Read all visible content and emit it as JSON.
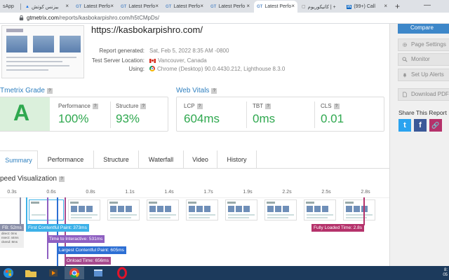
{
  "browser": {
    "tabs": [
      {
        "label": "sApp",
        "favicon": "",
        "active": false
      },
      {
        "label": "بيزنس كوتش",
        "favicon": "▲",
        "active": false
      },
      {
        "label": "Latest Perfo",
        "favicon": "GT",
        "active": false
      },
      {
        "label": "Latest Perfo",
        "favicon": "GT",
        "active": false
      },
      {
        "label": "Latest Perfo",
        "favicon": "GT",
        "active": false
      },
      {
        "label": "Latest Perfo",
        "favicon": "GT",
        "active": false
      },
      {
        "label": "Latest Perfo",
        "favicon": "GT",
        "active": true
      },
      {
        "label": "كاتيكوريوم | +",
        "favicon": "",
        "active": false
      },
      {
        "label": "(99+) Call",
        "favicon": "in",
        "active": false
      }
    ],
    "tab_close_glyph": "×",
    "new_tab_glyph": "+",
    "window_min_glyph": "—",
    "url_host": "gtmetrix.com",
    "url_path": "/reports/kasbokarpishro.com/h5tCMpDs/"
  },
  "report": {
    "site_url": "https://kasbokarpishro.com/",
    "meta": [
      {
        "label": "Report generated:",
        "value": "Sat, Feb 5, 2022 8:35 AM -0800"
      },
      {
        "label": "Test Server Location:",
        "value": "Vancouver, Canada"
      },
      {
        "label": "Using:",
        "value": "Chrome (Desktop) 90.0.4430.212, Lighthouse 8.3.0"
      }
    ]
  },
  "grade": {
    "title": "Tmetrix Grade",
    "help": "?",
    "letter": "A",
    "performance_label": "Performance",
    "performance_value": "100%",
    "structure_label": "Structure",
    "structure_value": "93%"
  },
  "vitals": {
    "title": "Web Vitals",
    "help": "?",
    "items": [
      {
        "label": "LCP",
        "value": "604ms"
      },
      {
        "label": "TBT",
        "value": "0ms"
      },
      {
        "label": "CLS",
        "value": "0.01"
      }
    ]
  },
  "tabs": [
    {
      "label": "Summary",
      "active": true
    },
    {
      "label": "Performance",
      "active": false
    },
    {
      "label": "Structure",
      "active": false
    },
    {
      "label": "Waterfall",
      "active": false
    },
    {
      "label": "Video",
      "active": false
    },
    {
      "label": "History",
      "active": false
    }
  ],
  "speed": {
    "title": "peed Visualization",
    "help": "?",
    "time_labels": [
      "0.3s",
      "0.6s",
      "0.8s",
      "1.1s",
      "1.4s",
      "1.7s",
      "1.9s",
      "2.2s",
      "2.5s",
      "2.8s"
    ],
    "markers": [
      {
        "label": "FB: 52ms",
        "color": "#8a8fa8"
      },
      {
        "label": "First Contentful Paint: 373ms",
        "color": "#3cb1e8"
      },
      {
        "label": "Time to Interactive: 531ms",
        "color": "#8e5fc1"
      },
      {
        "label": "Largest Contentful Paint: 605ms",
        "color": "#2d6fd4"
      },
      {
        "label": "Onload Time: 656ms",
        "color": "#a64a8d"
      },
      {
        "label": "Fully Loaded Time: 2.8s",
        "color": "#b5326b"
      }
    ],
    "details": [
      "direct: 0ms",
      "nnect: 44ms",
      "ckend: 8ms"
    ]
  },
  "sidebar": {
    "compare": "Compare",
    "buttons": [
      "Page Settings",
      "Monitor",
      "Set Up Alerts",
      "Download PDF"
    ],
    "share_title": "Share This Report",
    "share": [
      {
        "label": "t",
        "network": "twitter",
        "color": "#2aa3ef"
      },
      {
        "label": "f",
        "network": "facebook",
        "color": "#3b5998"
      },
      {
        "label": "🔗",
        "network": "link",
        "color": "#b5326b"
      }
    ]
  },
  "taskbar": {
    "clock_time": "8:",
    "clock_date": "05"
  }
}
